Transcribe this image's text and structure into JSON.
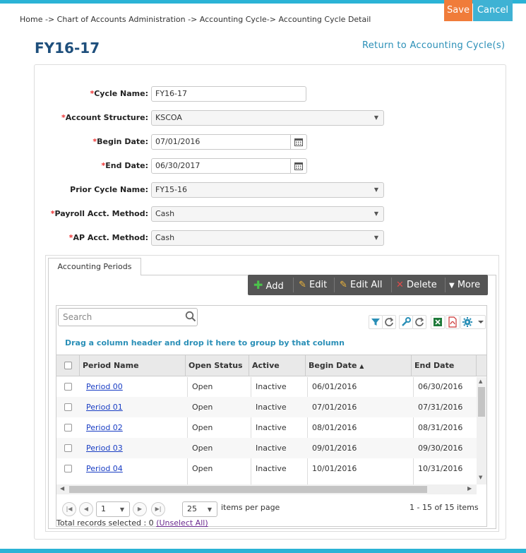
{
  "header": {
    "save_label": "Save",
    "cancel_label": "Cancel",
    "breadcrumb": "Home -> Chart of Accounts Administration -> Accounting Cycle-> Accounting Cycle Detail",
    "page_title": "FY16-17",
    "return_link": "Return to Accounting Cycle(s)"
  },
  "form": {
    "cycle_name": {
      "label": "Cycle Name:",
      "value": "FY16-17"
    },
    "account_structure": {
      "label": "Account Structure:",
      "value": "KSCOA"
    },
    "begin_date": {
      "label": "Begin Date:",
      "value": "07/01/2016"
    },
    "end_date": {
      "label": "End Date:",
      "value": "06/30/2017"
    },
    "prior_cycle": {
      "label": "Prior Cycle Name:",
      "value": "FY15-16"
    },
    "payroll_method": {
      "label": "Payroll Acct. Method:",
      "value": "Cash"
    },
    "ap_method": {
      "label": "AP Acct. Method:",
      "value": "Cash"
    },
    "required_mark": "*"
  },
  "tabs": {
    "active_label": "Accounting Periods"
  },
  "toolbar": {
    "add": "Add",
    "edit": "Edit",
    "edit_all": "Edit All",
    "delete": "Delete",
    "more": "More"
  },
  "grid": {
    "search_placeholder": "Search",
    "group_hint": "Drag a column header and drop it here to group by that column",
    "columns": {
      "period_name": "Period Name",
      "open_status": "Open Status",
      "active": "Active",
      "begin_date": "Begin Date",
      "end_date": "End Date"
    },
    "sort_indicator": "▲",
    "rows": [
      {
        "period": "Period 00",
        "status": "Open",
        "active": "Inactive",
        "begin": "06/01/2016",
        "end": "06/30/2016"
      },
      {
        "period": "Period 01",
        "status": "Open",
        "active": "Inactive",
        "begin": "07/01/2016",
        "end": "07/31/2016"
      },
      {
        "period": "Period 02",
        "status": "Open",
        "active": "Inactive",
        "begin": "08/01/2016",
        "end": "08/31/2016"
      },
      {
        "period": "Period 03",
        "status": "Open",
        "active": "Inactive",
        "begin": "09/01/2016",
        "end": "09/30/2016"
      },
      {
        "period": "Period 04",
        "status": "Open",
        "active": "Inactive",
        "begin": "10/01/2016",
        "end": "10/31/2016"
      }
    ]
  },
  "pager": {
    "page": "1",
    "page_size": "25",
    "items_per_page": "items per page",
    "summary": "1 - 15 of 15 items"
  },
  "footer": {
    "selected_text": "Total records selected : 0",
    "unselect_all": "(Unselect All)"
  },
  "colors": {
    "accent_blue": "#2bb3d6",
    "save_orange": "#f07c3a",
    "title_blue": "#1e4f7c",
    "link_blue": "#2a8fb7"
  }
}
